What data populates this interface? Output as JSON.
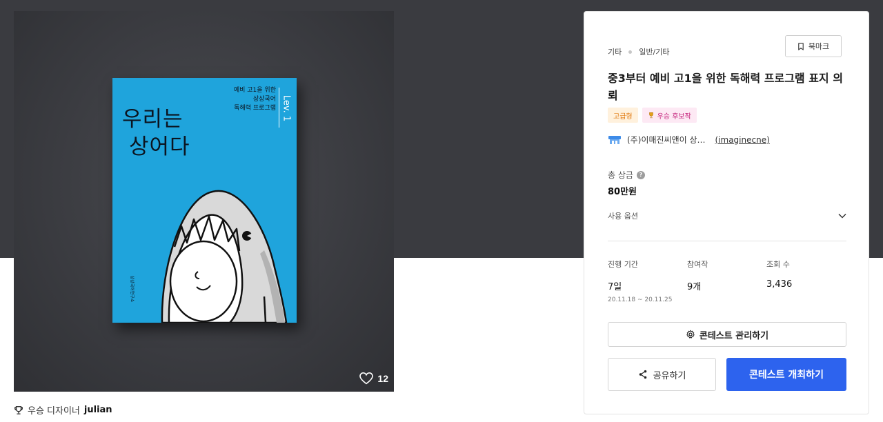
{
  "book": {
    "title_line1": "우리는",
    "title_line2": "상어다",
    "subtitle_lines": [
      "예비 고1을 위한",
      "상상국어",
      "독해력 프로그램"
    ],
    "level": "Lev. 1",
    "publisher": "상상국어연구소"
  },
  "likes": {
    "count": "12"
  },
  "winner": {
    "label": "우승 디자이너",
    "name": "julian"
  },
  "card": {
    "category_main": "기타",
    "category_sub": "일반/기타",
    "bookmark_label": "북마크",
    "title": "중3부터 예비 고1을 위한 독해력 프로그램 표지 의뢰",
    "badges": {
      "level": "고급형",
      "winner_candidate": "우승 후보작"
    },
    "host": {
      "name": "(주)이매진씨앤이 상…",
      "id": "(imaginecne)"
    },
    "prize": {
      "label": "총 상금",
      "help": "?",
      "value": "80만원"
    },
    "usage_options": "사용 옵션",
    "stats": {
      "period": {
        "label": "진행 기간",
        "value": "7일",
        "range": "20.11.18 ~ 20.11.25"
      },
      "entries": {
        "label": "참여작",
        "value": "9개"
      },
      "views": {
        "label": "조회 수",
        "value": "3,436"
      }
    },
    "buttons": {
      "manage": "콘테스트 관리하기",
      "share": "공유하기",
      "host": "콘테스트 개최하기"
    }
  },
  "colors": {
    "primary": "#2d63ee",
    "book_blue": "#1fa4dc",
    "dark_band": "#3a3b40"
  }
}
